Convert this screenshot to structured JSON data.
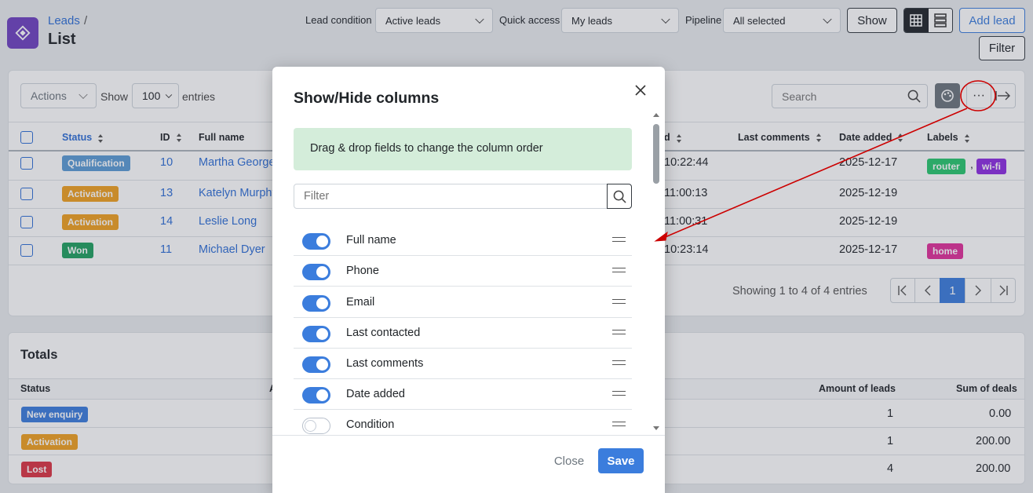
{
  "header": {
    "breadcrumb_parent": "Leads",
    "breadcrumb_sep": "/",
    "title": "List",
    "lead_condition_label": "Lead condition",
    "lead_condition_value": "Active leads",
    "quick_access_label": "Quick access",
    "quick_access_value": "My leads",
    "pipeline_label": "Pipeline",
    "pipeline_value": "All selected",
    "show_button": "Show",
    "add_lead_button": "Add lead",
    "filter_button": "Filter"
  },
  "toolbar": {
    "actions_label": "Actions",
    "show_label": "Show",
    "entries_value": "100",
    "entries_label": "entries",
    "search_placeholder": "Search"
  },
  "table": {
    "columns": [
      "Status",
      "ID",
      "Full name",
      "d",
      "Last comments",
      "Date added",
      "Labels"
    ],
    "rows": [
      {
        "status": "Qualification",
        "status_color": "#5b9bd5",
        "id": "10",
        "name": "Martha George",
        "time": "10:22:44",
        "date": "2025-12-17",
        "labels": [
          {
            "text": "router",
            "color": "#28c76f"
          },
          {
            "text": "wi-fi",
            "color": "#8e2de2"
          }
        ],
        "sep": ","
      },
      {
        "status": "Activation",
        "status_color": "#f0a020",
        "id": "13",
        "name": "Katelyn Murphy",
        "time": "11:00:13",
        "date": "2025-12-19",
        "labels": []
      },
      {
        "status": "Activation",
        "status_color": "#f0a020",
        "id": "14",
        "name": "Leslie Long",
        "time": "11:00:31",
        "date": "2025-12-19",
        "labels": []
      },
      {
        "status": "Won",
        "status_color": "#20a060",
        "id": "11",
        "name": "Michael Dyer",
        "time": "10:23:14",
        "date": "2025-12-17",
        "labels": [
          {
            "text": "home",
            "color": "#e0309a"
          }
        ]
      }
    ],
    "showing_text": "Showing 1 to 4 of 4 entries",
    "current_page": "1"
  },
  "totals": {
    "title": "Totals",
    "col_status": "Status",
    "col_a": "A",
    "col_amount": "Amount of leads",
    "col_sum": "Sum of deals",
    "rows": [
      {
        "status": "New enquiry",
        "color": "#3b7ddd",
        "amount": "1",
        "sum": "0.00"
      },
      {
        "status": "Activation",
        "color": "#f0a020",
        "amount": "1",
        "sum": "200.00"
      },
      {
        "status": "Lost",
        "color": "#dc3545",
        "amount": "4",
        "sum": "200.00"
      }
    ]
  },
  "modal": {
    "title": "Show/Hide columns",
    "info": "Drag & drop fields to change the column order",
    "filter_placeholder": "Filter",
    "columns": [
      {
        "label": "Full name",
        "enabled": true
      },
      {
        "label": "Phone",
        "enabled": true
      },
      {
        "label": "Email",
        "enabled": true
      },
      {
        "label": "Last contacted",
        "enabled": true
      },
      {
        "label": "Last comments",
        "enabled": true
      },
      {
        "label": "Date added",
        "enabled": true
      },
      {
        "label": "Condition",
        "enabled": false
      }
    ],
    "close_button": "Close",
    "save_button": "Save"
  },
  "colors": {
    "accent": "#3b7ddd",
    "logo": "#6f42c1",
    "info_bg": "#d4edda",
    "annotation": "#cc0000"
  }
}
